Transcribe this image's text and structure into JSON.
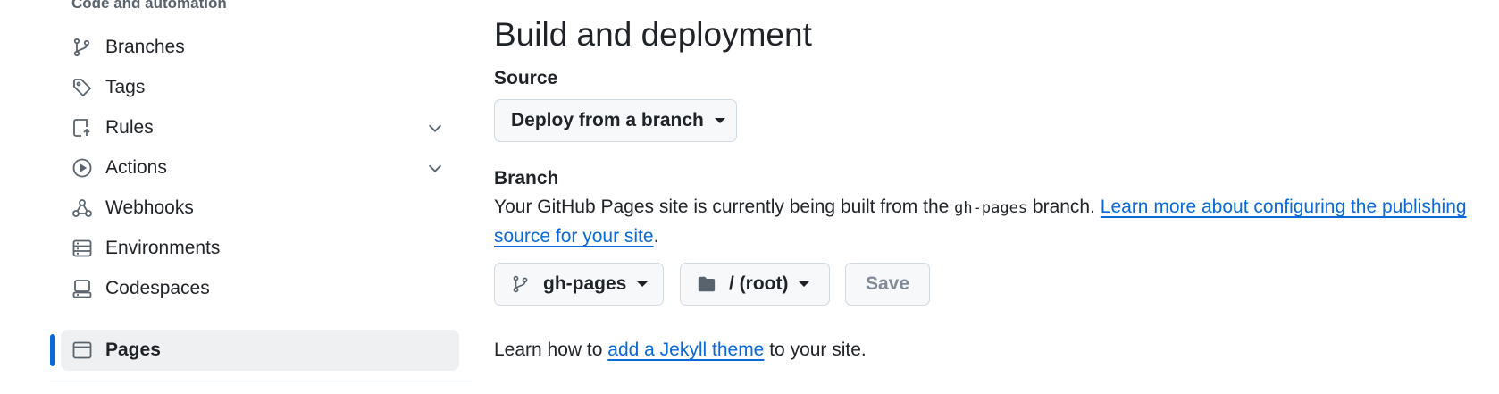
{
  "sidebar": {
    "section_heading": "Code and automation",
    "items": [
      {
        "label": "Branches",
        "icon": "git-branch-icon"
      },
      {
        "label": "Tags",
        "icon": "tag-icon"
      },
      {
        "label": "Rules",
        "icon": "repo-push-icon",
        "expandable": true
      },
      {
        "label": "Actions",
        "icon": "play-icon",
        "expandable": true
      },
      {
        "label": "Webhooks",
        "icon": "webhook-icon"
      },
      {
        "label": "Environments",
        "icon": "server-icon"
      },
      {
        "label": "Codespaces",
        "icon": "codespaces-icon"
      },
      {
        "label": "Pages",
        "icon": "browser-icon",
        "active": true
      }
    ]
  },
  "main": {
    "title": "Build and deployment",
    "source": {
      "label": "Source",
      "dropdown_label": "Deploy from a branch"
    },
    "branch": {
      "label": "Branch",
      "desc_prefix": "Your GitHub Pages site is currently being built from the",
      "branch_code": "gh-pages",
      "desc_suffix": "branch.",
      "learn_more_link": "Learn more about configuring the publishing source for your site",
      "period": ".",
      "branch_select": "gh-pages",
      "folder_select": "/ (root)",
      "save_label": "Save"
    },
    "footer": {
      "prefix": "Learn how to",
      "link": "add a Jekyll theme",
      "suffix": "to your site."
    }
  },
  "colors": {
    "accent": "#0969da",
    "text": "#1f2328",
    "muted": "#59636e",
    "active_bg": "#eef0f2",
    "border": "#d1d9e0"
  }
}
